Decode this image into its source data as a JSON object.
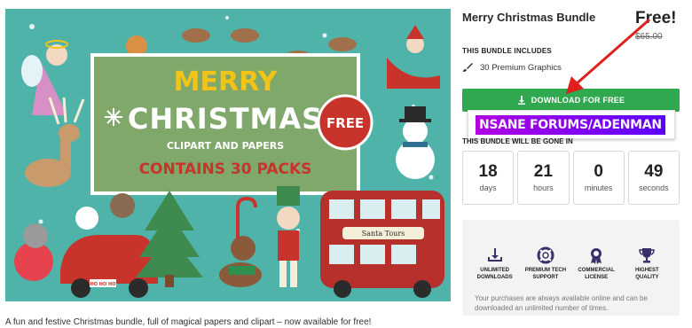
{
  "product": {
    "title": "Merry Christmas Bundle",
    "price_free": "Free!",
    "price_old": "$65.00",
    "caption": "A fun and festive Christmas bundle, full of magical papers and clipart – now available for free!"
  },
  "artwork": {
    "line1": "MERRY",
    "line2": "CHRISTMAS",
    "line3": "CLIPART AND PAPERS",
    "line4": "CONTAINS 30 PACKS",
    "badge": "FREE",
    "bus_sign": "Santa Tours",
    "plate": "HO HO HO",
    "colors": {
      "background": "#4fb3aa",
      "panel": "#7fa86a",
      "red": "#c8332c",
      "yellow": "#f2c418"
    }
  },
  "includes": {
    "label": "THIS BUNDLE INCLUDES",
    "item": "30 Premium Graphics",
    "icon": "paintbrush-icon"
  },
  "download": {
    "label": "DOWNLOAD FOR FREE",
    "icon": "download-icon",
    "color": "#2fa84f"
  },
  "watermark": {
    "text": "NSANE FORUMS/ADENMAN"
  },
  "countdown": {
    "label": "THIS BUNDLE WILL BE GONE IN",
    "units": [
      {
        "value": "18",
        "unit": "days"
      },
      {
        "value": "21",
        "unit": "hours"
      },
      {
        "value": "0",
        "unit": "minutes"
      },
      {
        "value": "49",
        "unit": "seconds"
      }
    ]
  },
  "features": {
    "items": [
      {
        "line1": "UNLIMITED",
        "line2": "DOWNLOADS",
        "icon": "download-tray-icon"
      },
      {
        "line1": "PREMIUM TECH",
        "line2": "SUPPORT",
        "icon": "lifebuoy-icon"
      },
      {
        "line1": "COMMERCIAL",
        "line2": "LICENSE",
        "icon": "license-badge-icon"
      },
      {
        "line1": "HIGHEST",
        "line2": "QUALITY",
        "icon": "trophy-icon"
      }
    ],
    "note": "Your purchases are always available online and can be downloaded an unlimited number of times.",
    "icon_color": "#3b2f6b"
  },
  "annotation": {
    "arrow_color": "#e0201e"
  }
}
